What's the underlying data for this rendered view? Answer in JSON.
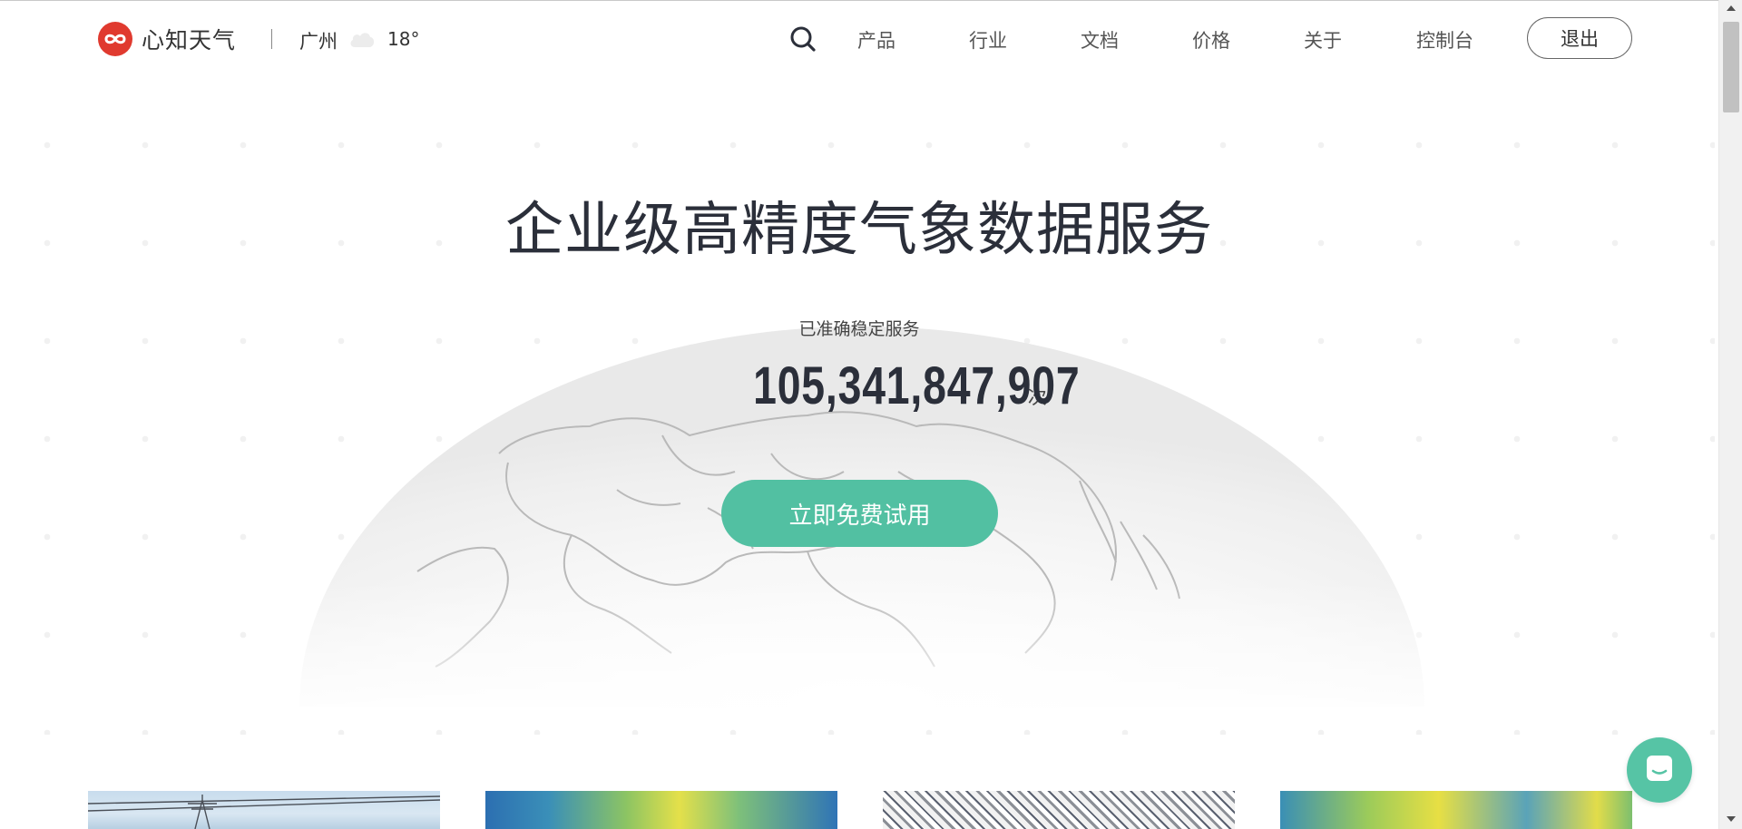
{
  "header": {
    "brand": "心知天气",
    "city": "广州",
    "temperature": "18°",
    "weather_icon": "cloud-icon",
    "nav": [
      "产品",
      "行业",
      "文档",
      "价格",
      "关于",
      "控制台"
    ],
    "logout_label": "退出"
  },
  "hero": {
    "title": "企业级高精度气象数据服务",
    "subtitle": "已准确稳定服务",
    "counter": "105,341,847,907",
    "counter_unit": "次",
    "cta_label": "立即免费试用"
  },
  "colors": {
    "brand_red": "#e03a2f",
    "accent_green": "#52c0a2",
    "text_dark": "#2b2f3a"
  },
  "widgets": {
    "chat_icon": "chat-icon"
  }
}
